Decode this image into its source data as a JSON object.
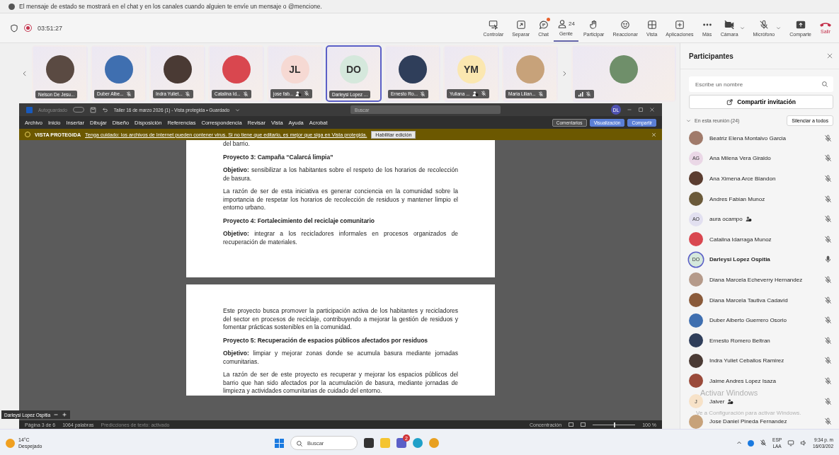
{
  "notice": {
    "text": "El mensaje de estado se mostrará en el chat y en los canales cuando alguien te envíe un mensaje o @mencione."
  },
  "meeting": {
    "timer": "03:51:27",
    "recording": true
  },
  "toolbar": [
    {
      "label": "Controlar",
      "kind": "button",
      "selected": false,
      "notification": false
    },
    {
      "label": "Separar",
      "kind": "button",
      "selected": false,
      "notification": false
    },
    {
      "label": "Chat",
      "kind": "button",
      "selected": false,
      "notification": true
    },
    {
      "label": "Gente",
      "kind": "button",
      "selected": true,
      "notification": false,
      "count": "24"
    },
    {
      "label": "Participar",
      "kind": "button",
      "selected": false,
      "notification": false
    },
    {
      "label": "Reaccionar",
      "kind": "button",
      "selected": false,
      "notification": false
    },
    {
      "label": "Vista",
      "kind": "button",
      "selected": false,
      "notification": false
    },
    {
      "label": "Aplicaciones",
      "kind": "button",
      "selected": false,
      "notification": false
    },
    {
      "label": "Más",
      "kind": "button",
      "selected": false,
      "notification": false
    },
    {
      "label": "Cámara",
      "kind": "split",
      "selected": false,
      "notification": false
    },
    {
      "label": "Micrófono",
      "kind": "split",
      "selected": false,
      "notification": false
    },
    {
      "label": "Comparte",
      "kind": "button",
      "selected": false,
      "notification": false
    },
    {
      "label": "Salir",
      "kind": "leave",
      "selected": false,
      "notification": false
    }
  ],
  "thumbnails": [
    {
      "label": "Nelson De Jesu...",
      "kind": "photo",
      "color": "#5a4a42",
      "selected": false,
      "muted": false,
      "guest": false
    },
    {
      "label": "Duber Albe...",
      "kind": "photo",
      "color": "#3f6fb0",
      "selected": false,
      "muted": true,
      "guest": false
    },
    {
      "label": "Indra Yuliet...",
      "kind": "photo",
      "color": "#4a3a34",
      "selected": false,
      "muted": true,
      "guest": false
    },
    {
      "label": "Catalina Id...",
      "kind": "photo",
      "color": "#d9474f",
      "selected": false,
      "muted": true,
      "guest": false
    },
    {
      "label": "jose fab...",
      "kind": "initials",
      "initials": "JL",
      "color": "#f6d9d3",
      "selected": false,
      "muted": true,
      "guest": true
    },
    {
      "label": "Darleysi Lopez ...",
      "kind": "initials",
      "initials": "DO",
      "color": "#d5e8dc",
      "selected": true,
      "muted": false,
      "guest": false
    },
    {
      "label": "Ernesto Ro...",
      "kind": "photo",
      "color": "#2f3e5a",
      "selected": false,
      "muted": true,
      "guest": false
    },
    {
      "label": "Yuliana ...",
      "kind": "initials",
      "initials": "YM",
      "color": "#fbe7b0",
      "selected": false,
      "muted": true,
      "guest": true
    },
    {
      "label": "Maria Lilian...",
      "kind": "photo",
      "color": "#c7a27a",
      "selected": false,
      "muted": true,
      "guest": false
    }
  ],
  "featured_tile": {
    "kind": "photo",
    "color": "#6f8f6a",
    "muted": true
  },
  "word": {
    "autosave": "Autoguardado",
    "autosave_on": false,
    "title": "Taller 16 de marzo 2026 (1) - Vista protegida • Guardado",
    "search": {
      "placeholder": "Buscar"
    },
    "user_initials": "DL",
    "menu": [
      "Archivo",
      "Inicio",
      "Insertar",
      "Dibujar",
      "Diseño",
      "Disposición",
      "Referencias",
      "Correspondencia",
      "Revisar",
      "Vista",
      "Ayuda",
      "Acrobat"
    ],
    "actions": [
      "Comentarios",
      "Visualización",
      "Compartir"
    ],
    "protected": {
      "label": "VISTA PROTEGIDA",
      "message": "Tenga cuidado: los archivos de Internet pueden contener virus. Si no tiene que editarlo, es mejor que siga en Vista protegida.",
      "button": "Habilitar edición"
    },
    "pages": [
      {
        "blocks": [
          {
            "kind": "para",
            "text": "del barrio."
          },
          {
            "kind": "heading",
            "text": "Proyecto 3: Campaña “Calarcá limpia”"
          },
          {
            "kind": "para",
            "text": "**Objetivo:** sensibilizar a los habitantes sobre el respeto de los horarios de recolección de basura."
          },
          {
            "kind": "para",
            "text": "La razón de ser de esta iniciativa es generar conciencia en la comunidad sobre la importancia de respetar los horarios de recolección de residuos y mantener limpio el entorno urbano."
          },
          {
            "kind": "heading",
            "text": "Proyecto 4: Fortalecimiento del reciclaje comunitario"
          },
          {
            "kind": "para",
            "text": "**Objetivo:** integrar a los recicladores informales en procesos organizados de recuperación de materiales."
          }
        ]
      },
      {
        "blocks": [
          {
            "kind": "para",
            "text": "Este proyecto busca promover la participación activa de los habitantes y recicladores del sector en procesos de reciclaje, contribuyendo a mejorar la gestión de residuos y fomentar prácticas sostenibles en la comunidad."
          },
          {
            "kind": "heading",
            "text": "Proyecto 5: Recuperación de espacios públicos afectados por residuos"
          },
          {
            "kind": "para",
            "text": "**Objetivo:** limpiar y mejorar zonas donde se acumula basura mediante jornadas comunitarias."
          },
          {
            "kind": "para",
            "text": "La razón de ser de este proyecto es recuperar y mejorar los espacios públicos del barrio que han sido afectados por la acumulación de basura, mediante jornadas de limpieza y actividades comunitarias de cuidado del entorno."
          }
        ]
      }
    ],
    "status": {
      "page": "Página 3 de 6",
      "words": "1064 palabras",
      "predictions": "Predicciones de texto: activado",
      "focus": "Concentración",
      "zoom": "100 %",
      "level": 0.5
    }
  },
  "presenter_label": "Darleysi Lopez Ospitia",
  "panel": {
    "title": "Participantes",
    "search": {
      "placeholder": "Escribe un nombre"
    },
    "invite": "Compartir invitación",
    "section": "En esta reunión (24)",
    "expanded": true,
    "mute_all": "Silenciar a todos",
    "participants": [
      {
        "name": "Beatriz Elena Montalvo Garcia",
        "kind": "photo",
        "color": "#a07a6a",
        "guest": false,
        "muted": true
      },
      {
        "name": "Ana Milena Vera Giraldo",
        "kind": "initials",
        "initials": "AG",
        "color": "#ead7e6",
        "guest": false,
        "muted": true
      },
      {
        "name": "Ana Ximena Arce Blandon",
        "kind": "photo",
        "color": "#5b3d30",
        "guest": false,
        "muted": true
      },
      {
        "name": "Andres Fabian Munoz",
        "kind": "photo",
        "color": "#6b5a3a",
        "guest": false,
        "muted": true
      },
      {
        "name": "aura ocampo",
        "kind": "initials",
        "initials": "AO",
        "color": "#e2e0f0",
        "guest": true,
        "muted": true
      },
      {
        "name": "Catalina Idarraga Munoz",
        "kind": "photo",
        "color": "#d9474f",
        "guest": false,
        "muted": true
      },
      {
        "name": "Darleysi Lopez Ospitia",
        "kind": "initials",
        "initials": "DO",
        "color": "#d5e8dc",
        "guest": false,
        "muted": false
      },
      {
        "name": "Diana Marcela Echeverry Hernandez",
        "kind": "photo",
        "color": "#b59a8a",
        "guest": false,
        "muted": true
      },
      {
        "name": "Diana Marcela Tautiva Cadavid",
        "kind": "photo",
        "color": "#8a5a3a",
        "guest": false,
        "muted": true
      },
      {
        "name": "Duber Alberto Guerrero Osorio",
        "kind": "photo",
        "color": "#3f6fb0",
        "guest": false,
        "muted": true
      },
      {
        "name": "Ernesto Romero Beltran",
        "kind": "photo",
        "color": "#2f3e5a",
        "guest": false,
        "muted": true
      },
      {
        "name": "Indra Yuliet Ceballos Ramirez",
        "kind": "photo",
        "color": "#4a3a34",
        "guest": false,
        "muted": true
      },
      {
        "name": "Jaime Andres Lopez Isaza",
        "kind": "photo",
        "color": "#9a4a3a",
        "guest": false,
        "muted": true
      },
      {
        "name": "Jaiver",
        "kind": "initials",
        "initials": "J",
        "color": "#f7e2c8",
        "guest": true,
        "muted": true
      },
      {
        "name": "Jose Daniel Pineda Fernandez",
        "kind": "photo",
        "color": "#c7a27a",
        "guest": false,
        "muted": true
      }
    ]
  },
  "activation": {
    "title": "Activar Windows",
    "message": "Ve a Configuración para activar Windows."
  },
  "taskbar": {
    "temperature": "14°C",
    "condition": "Despejado",
    "search": {
      "placeholder": "Buscar"
    },
    "teams_badge": "2",
    "language": "ESP",
    "layout": "LAA",
    "time": "9:34 p. m",
    "date": "16/03/202"
  }
}
